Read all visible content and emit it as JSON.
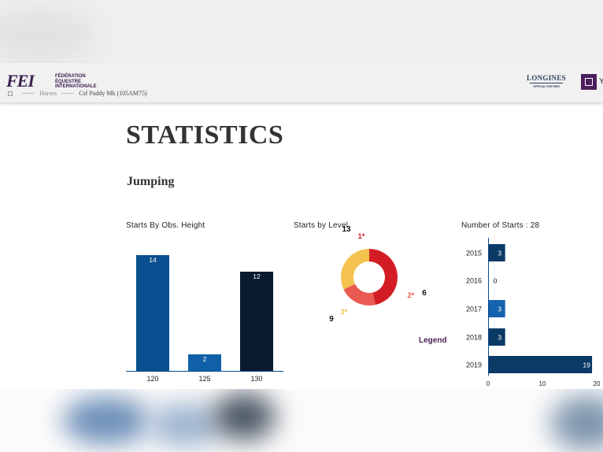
{
  "header": {
    "logo_mark": "FEI",
    "logo_lines": [
      "FÉDÉRATION",
      "ÉQUESTRE",
      "INTERNATIONALE"
    ],
    "breadcrumb": [
      "Horses",
      "Csf Paddy Mk (105AM75)"
    ],
    "sponsor_name": "LONGINES",
    "sponsor_sub": "OFFICIAL PARTNER",
    "user_letter": "Y"
  },
  "page": {
    "title": "STATISTICS",
    "subtitle": "Jumping",
    "legend_label": "Legend"
  },
  "colors": {
    "navy": "#0a4a8c",
    "dark_navy": "#0b1e33",
    "mid_blue": "#1a5fa8",
    "red": "#d11b22",
    "salmon": "#ea5a52",
    "yellow": "#f2c14e",
    "purple": "#4a1e5a"
  },
  "chart_data": [
    {
      "type": "bar",
      "title": "Starts By Obs. Height",
      "categories": [
        "120",
        "125",
        "130"
      ],
      "values": [
        14,
        2,
        12
      ],
      "bar_colors": [
        "#0a4f8f",
        "#1060a8",
        "#071a2e"
      ],
      "ylim": [
        0,
        14
      ]
    },
    {
      "type": "pie",
      "title": "Starts by Level",
      "labels": [
        "1*",
        "2*",
        "3*"
      ],
      "values": [
        13,
        6,
        9
      ],
      "slice_colors": [
        "#d31d25",
        "#ea5a52",
        "#f4c24f"
      ],
      "label_colors": [
        "#d31d25",
        "#ea5a52",
        "#f4c24f"
      ]
    },
    {
      "type": "bar",
      "orientation": "horizontal",
      "title": "Number of Starts : 28",
      "categories": [
        "2015",
        "2016",
        "2017",
        "2018",
        "2019"
      ],
      "values": [
        3,
        0,
        3,
        3,
        19
      ],
      "bar_colors": [
        "#0b3a66",
        "#0b3a66",
        "#1562ad",
        "#0b3a66",
        "#0b3a66"
      ],
      "xticks": [
        0,
        10,
        20
      ],
      "xlim": [
        0,
        20
      ]
    }
  ]
}
